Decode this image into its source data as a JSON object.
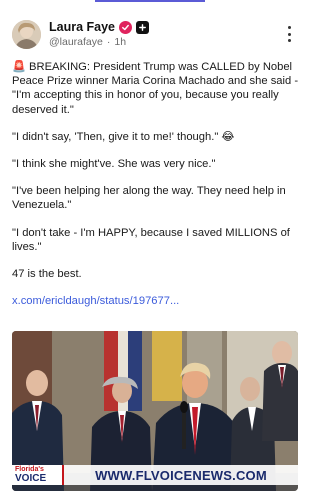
{
  "post": {
    "author": {
      "display_name": "Laura Faye",
      "handle": "@laurafaye",
      "separator": "·",
      "time_ago": "1h"
    },
    "paragraphs": [
      "🚨 BREAKING: President Trump was CALLED by Nobel Peace Prize winner Maria Corina Machado and she said - \"I'm accepting this in honor of you, because you really deserved it.\"",
      "\"I didn't say, 'Then, give it to me!' though.\" 😂",
      "\"I think she might've. She was very nice.\"",
      "\"I've been helping her along the way. They need help in Venezuela.\"",
      "\"I don't take - I'm HAPPY, because I saved MILLIONS of lives.\"",
      "47 is the best."
    ],
    "link_text": "x.com/ericldaugh/status/197677...",
    "media": {
      "watermark_logo_top": "Florida's",
      "watermark_logo_bottom": "VOICE",
      "watermark_url": "WWW.FLVOICENEWS.COM"
    }
  },
  "colors": {
    "link": "#3b5bdb",
    "verified": "#e0245e",
    "accent_bar": "#5b5bd6",
    "watermark_red": "#c4161c",
    "watermark_navy": "#1a2a6c"
  },
  "icons": {
    "verified": "verified-check-icon",
    "plus": "plus-badge-icon",
    "more": "more-vertical-icon"
  }
}
